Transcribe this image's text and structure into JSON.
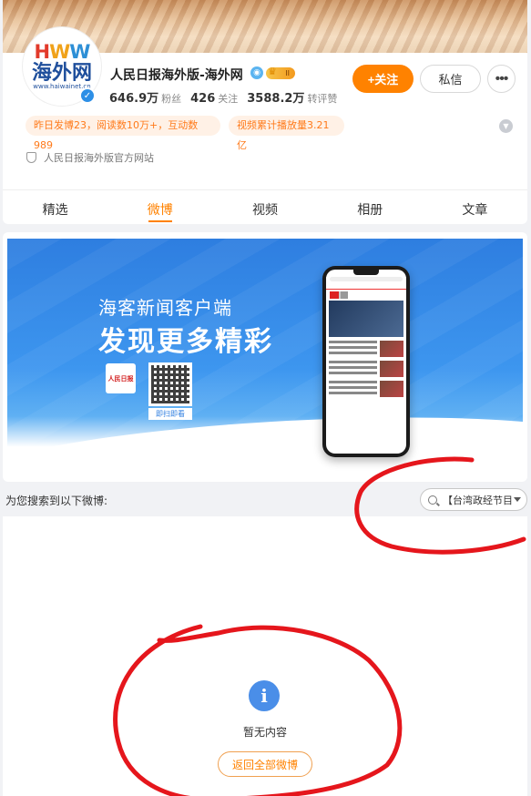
{
  "profile": {
    "name": "人民日报海外版-海外网",
    "avatar_logo_top": [
      "H",
      "W",
      "W"
    ],
    "avatar_logo_main": "海外网",
    "avatar_logo_url": "www.haiwainet.cn",
    "level_badge": "II",
    "stats": [
      {
        "value": "646.9万",
        "label": "粉丝"
      },
      {
        "value": "426",
        "label": "关注"
      },
      {
        "value": "3588.2万",
        "label": "转评赞"
      }
    ],
    "follow_label": "+关注",
    "message_label": "私信",
    "more_label": "•••",
    "tags": [
      "昨日发博23，阅读数10万+，互动数989",
      "视频累计播放量3.21亿"
    ],
    "website": "人民日报海外版官方网站"
  },
  "tabs": [
    {
      "label": "精选",
      "active": false
    },
    {
      "label": "微博",
      "active": true
    },
    {
      "label": "视频",
      "active": false
    },
    {
      "label": "相册",
      "active": false
    },
    {
      "label": "文章",
      "active": false
    }
  ],
  "banner": {
    "line1": "海客新闻客户端",
    "line2": "发现更多精彩",
    "logo_text": "人民日报",
    "qr_caption": "即扫即看"
  },
  "search": {
    "label": "为您搜索到以下微博:",
    "value": "【台湾政经节目"
  },
  "empty": {
    "message": "暂无内容",
    "back_label": "返回全部微博"
  },
  "colors": {
    "accent": "#ff8200",
    "annotation": "#e5161c",
    "info": "#4a8ee8"
  }
}
